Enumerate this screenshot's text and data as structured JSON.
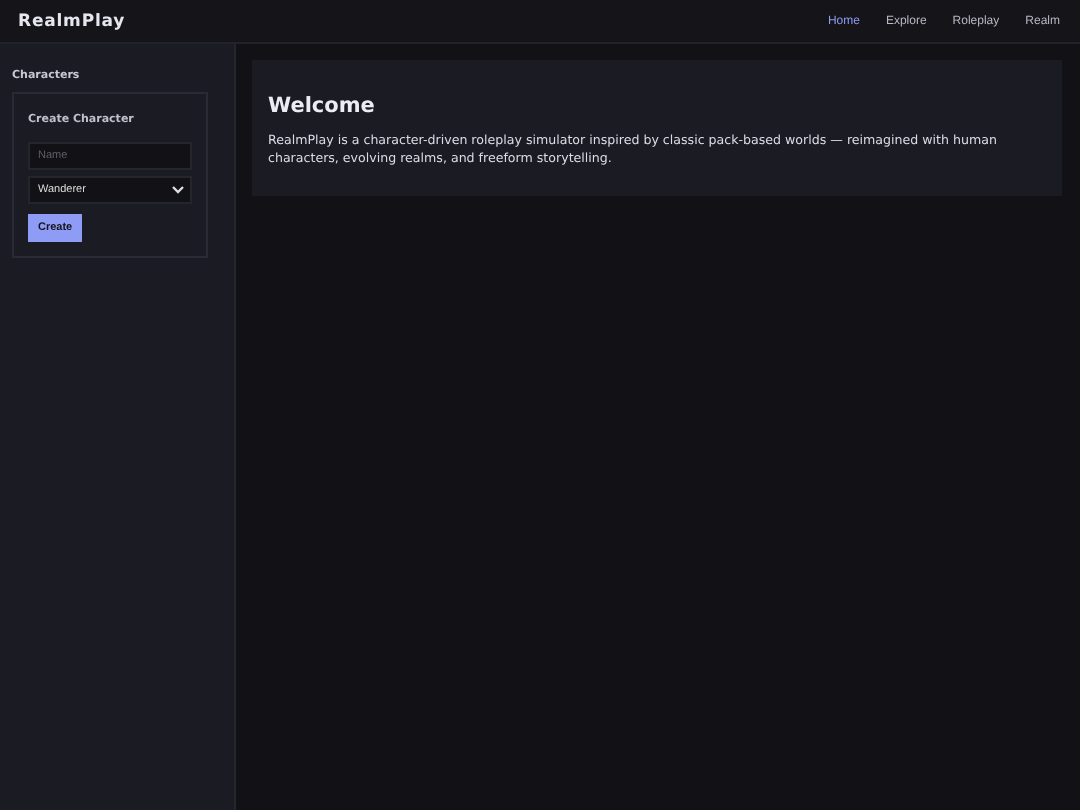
{
  "header": {
    "brand": "RealmPlay",
    "nav": [
      {
        "label": "Home",
        "selected": true
      },
      {
        "label": "Explore",
        "selected": false
      },
      {
        "label": "Roleplay",
        "selected": false
      },
      {
        "label": "Realm",
        "selected": false
      }
    ]
  },
  "sidebar": {
    "title": "Characters",
    "form": {
      "title": "Create Character",
      "name_placeholder": "Name",
      "class_value": "Wanderer",
      "button": "Create"
    }
  },
  "welcome": {
    "title": "Welcome",
    "text": "RealmPlay is a character-driven roleplay simulator inspired by classic pack-based worlds — reimagined with human characters, evolving realms, and freeform storytelling."
  }
}
